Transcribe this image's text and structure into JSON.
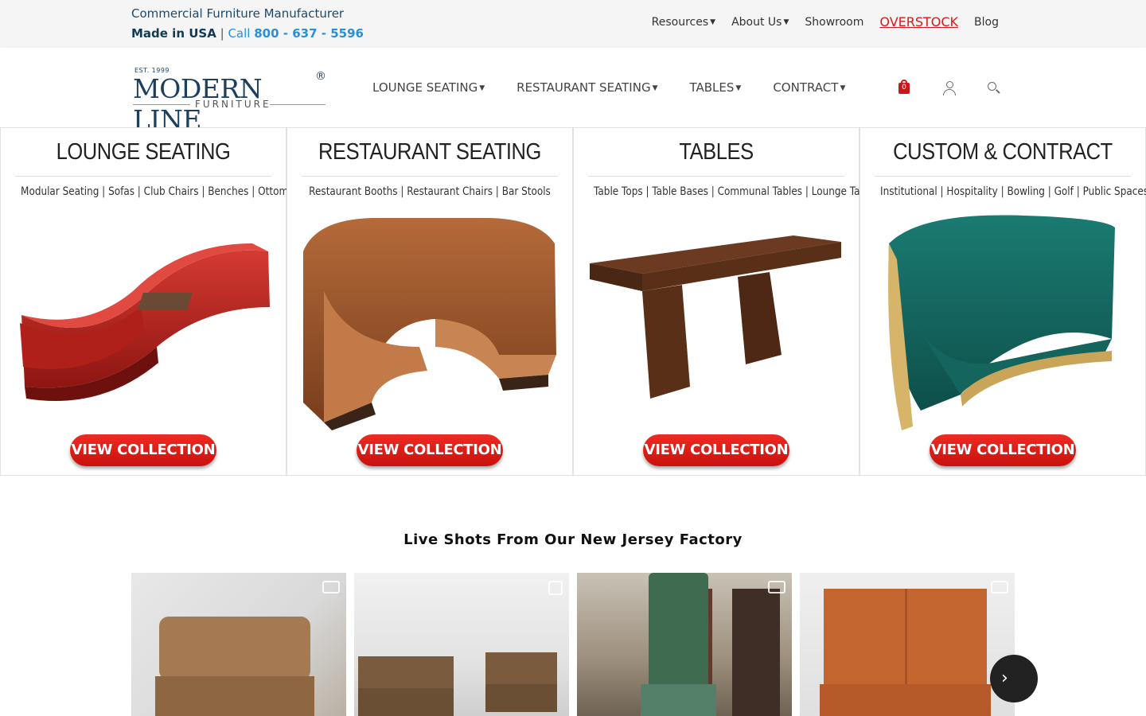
{
  "topbar": {
    "tagline": "Commercial Furniture Manufacturer",
    "made_in": "Made in USA",
    "separator": "|",
    "call_label": "Call",
    "phone": "800 - 637 - 5596",
    "links": [
      {
        "label": "Resources",
        "dropdown": true
      },
      {
        "label": "About Us",
        "dropdown": true
      },
      {
        "label": "Showroom",
        "dropdown": false
      },
      {
        "label": "OVERSTOCK",
        "dropdown": false
      },
      {
        "label": "Blog",
        "dropdown": false
      }
    ]
  },
  "logo": {
    "est": "EST. 1999",
    "brand": "MODERN LINE",
    "reg": "®",
    "sub": "FURNITURE"
  },
  "nav": {
    "items": [
      {
        "label": "LOUNGE SEATING"
      },
      {
        "label": "RESTAURANT SEATING"
      },
      {
        "label": "TABLES"
      },
      {
        "label": "CONTRACT"
      }
    ],
    "cart_count": "0",
    "icons": [
      "cart-icon",
      "user-icon",
      "search-icon"
    ]
  },
  "categories": [
    {
      "title": "LOUNGE SEATING",
      "sub": "Modular Seating | Sofas | Club Chairs | Benches | Ottomans",
      "button": "VIEW COLLECTION"
    },
    {
      "title": "RESTAURANT SEATING",
      "sub": "Restaurant Booths | Restaurant Chairs | Bar Stools",
      "button": "VIEW COLLECTION"
    },
    {
      "title": "TABLES",
      "sub": "Table Tops | Table Bases | Communal Tables | Lounge Tables",
      "button": "VIEW COLLECTION"
    },
    {
      "title": "CUSTOM & CONTRACT",
      "sub": "Institutional | Hospitality | Bowling | Golf | Public Spaces",
      "button": "VIEW COLLECTION"
    }
  ],
  "live": {
    "title": "Live Shots From Our New Jersey Factory"
  },
  "colors": {
    "accent_red": "#d41b1b",
    "brand_navy": "#1d3f5f",
    "phone_blue": "#2a8fd8"
  }
}
